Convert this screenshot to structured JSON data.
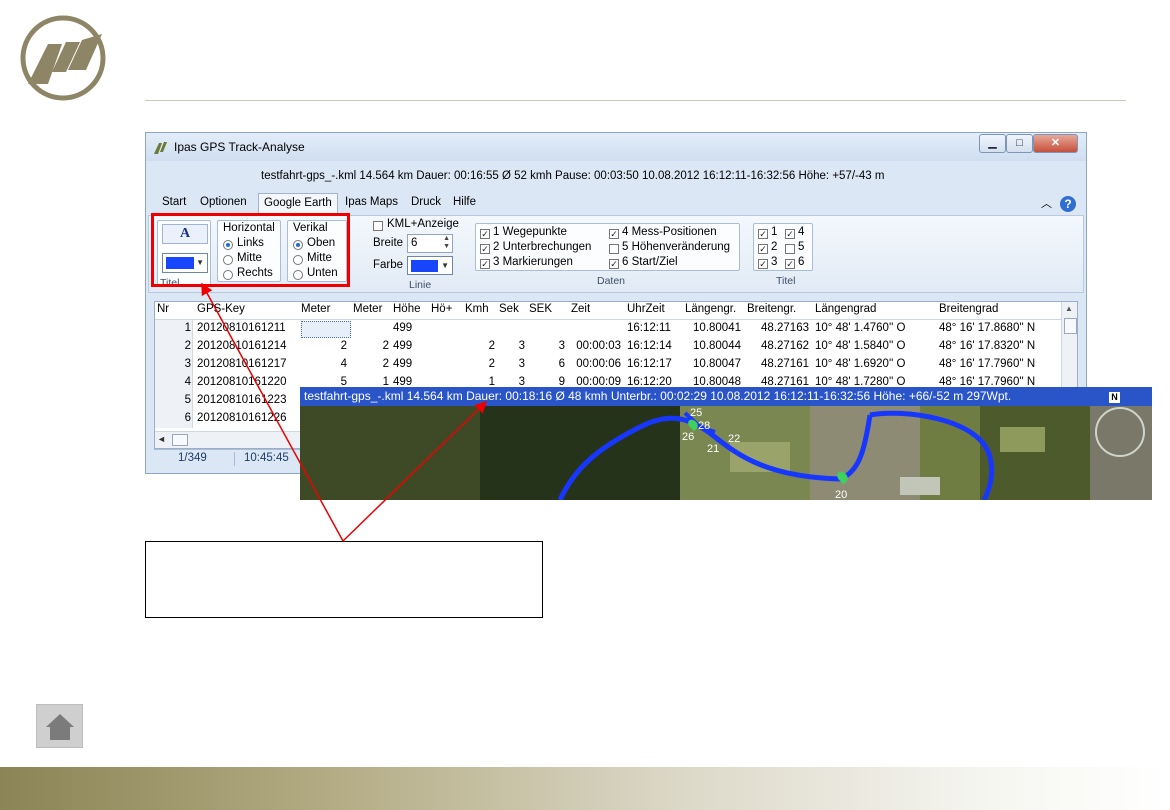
{
  "app": {
    "title": "Ipas GPS Track-Analyse",
    "status": "testfahrt-gps_-.kml  14.564 km  Dauer: 00:16:55  Ø 52 kmh  Pause: 00:03:50  10.08.2012 16:12:11-16:32:56   Höhe: +57/-43 m"
  },
  "menu": [
    "Start",
    "Optionen",
    "Google Earth",
    "Ipas Maps",
    "Druck",
    "Hilfe"
  ],
  "ribbon": {
    "titel_group": {
      "label": "Titel",
      "font_btn": "A",
      "color": "#1845ff"
    },
    "horizontal": {
      "label": "Horizontal",
      "options": [
        "Links",
        "Mitte",
        "Rechts"
      ],
      "selected": "Links"
    },
    "vertical": {
      "label": "Verikal",
      "options": [
        "Oben",
        "Mitte",
        "Unten"
      ],
      "selected": "Oben"
    },
    "linie": {
      "label": "Linie",
      "kml_label": "KML+Anzeige",
      "kml_checked": false,
      "breite_label": "Breite",
      "breite_value": "6",
      "farbe_label": "Farbe",
      "color": "#1845ff"
    },
    "daten": {
      "label": "Daten",
      "items": [
        {
          "text": "1 Wegepunkte",
          "checked": true
        },
        {
          "text": "4 Mess-Positionen",
          "checked": true
        },
        {
          "text": "2 Unterbrechungen",
          "checked": true
        },
        {
          "text": "5 Höhenveränderung",
          "checked": false
        },
        {
          "text": "3 Markierungen",
          "checked": true
        },
        {
          "text": "6 Start/Ziel",
          "checked": true
        }
      ]
    },
    "titel2": {
      "label": "Titel",
      "items": [
        {
          "text": "1",
          "checked": true
        },
        {
          "text": "4",
          "checked": true
        },
        {
          "text": "2",
          "checked": true
        },
        {
          "text": "5",
          "checked": false
        },
        {
          "text": "3",
          "checked": true
        },
        {
          "text": "6",
          "checked": true
        }
      ]
    }
  },
  "table": {
    "columns": [
      "Nr",
      "GPS-Key",
      "Meter",
      "Meter",
      "Höhe",
      "Hö+",
      "Kmh",
      "Sek",
      "SEK",
      "Zeit",
      "UhrZeit",
      "Längengr.",
      "Breitengr.",
      "Längengrad",
      "Breitengrad"
    ],
    "rows": [
      [
        "1",
        "20120810161211",
        "",
        "",
        "499",
        "",
        "",
        "",
        "",
        "",
        "16:12:11",
        "10.80041",
        "48.27163",
        "10° 48' 1.4760'' O",
        "48° 16' 17.8680'' N"
      ],
      [
        "2",
        "20120810161214",
        "2",
        "2",
        "499",
        "",
        "2",
        "3",
        "3",
        "00:00:03",
        "16:12:14",
        "10.80044",
        "48.27162",
        "10° 48' 1.5840'' O",
        "48° 16' 17.8320'' N"
      ],
      [
        "3",
        "20120810161217",
        "4",
        "2",
        "499",
        "",
        "2",
        "3",
        "6",
        "00:00:06",
        "16:12:17",
        "10.80047",
        "48.27161",
        "10° 48' 1.6920'' O",
        "48° 16' 17.7960'' N"
      ],
      [
        "4",
        "20120810161220",
        "5",
        "1",
        "499",
        "",
        "1",
        "3",
        "9",
        "00:00:09",
        "16:12:20",
        "10.80048",
        "48.27161",
        "10° 48' 1.7280'' O",
        "48° 16' 17.7960'' N"
      ],
      [
        "5",
        "20120810161223",
        "",
        "",
        "",
        "",
        "",
        "",
        "",
        "",
        "",
        "",
        "",
        "",
        ""
      ],
      [
        "6",
        "20120810161226",
        "",
        "",
        "",
        "",
        "",
        "",
        "",
        "",
        "",
        "",
        "",
        "",
        ""
      ]
    ]
  },
  "statusbar": {
    "position": "1/349",
    "time": "10:45:45"
  },
  "map": {
    "bar": "testfahrt-gps_-.kml  14.564 km  Dauer: 00:18:16  Ø 48 kmh  Unterbr.: 00:02:29  10.08.2012 16:12:11-16:32:56   Höhe: +66/-52 m  297Wpt.",
    "compass": "N",
    "markers": [
      "25",
      "26",
      "28",
      "21",
      "22",
      "20"
    ]
  }
}
